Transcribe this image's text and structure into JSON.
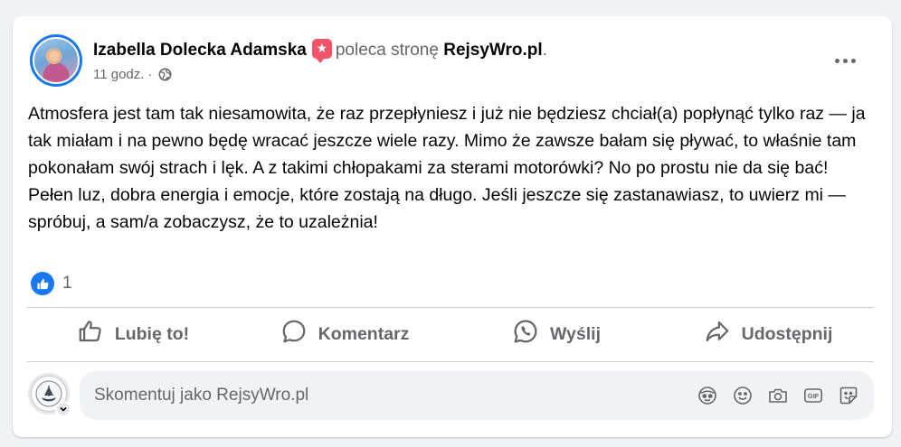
{
  "post": {
    "author": "Izabella Dolecka Adamska",
    "recommends_text": "poleca stronę",
    "page_name": "RejsyWro.pl",
    "page_suffix": ".",
    "time": "11 godz.",
    "separator": "·",
    "privacy_icon": "globe-icon",
    "text": "Atmosfera jest tam tak niesamowita, że raz przepłyniesz i już nie będziesz chciał(a) popłynąć tylko raz — ja tak miałam i na pewno będę wracać jeszcze wiele razy. Mimo że zawsze bałam się pływać, to właśnie tam pokonałam swój strach i lęk. A z takimi chłopakami za sterami motorówki? No po prostu nie da się bać! Pełen luz, dobra energia i emocje, które zostają na długo. Jeśli jeszcze się zastanawiasz, to uwierz mi — spróbuj, a sam/a zobaczysz, że to uzależnia!"
  },
  "reactions": {
    "icon": "like-icon",
    "count": "1"
  },
  "actions": {
    "like_label": "Lubię to!",
    "comment_label": "Komentarz",
    "send_label": "Wyślij",
    "share_label": "Udostępnij"
  },
  "comment": {
    "placeholder": "Skomentuj jako RejsyWro.pl",
    "tools": [
      "avatar-sticker-icon",
      "emoji-icon",
      "camera-icon",
      "gif-icon",
      "sticker-icon"
    ]
  },
  "colors": {
    "accent": "#1877f2",
    "recommend": "#f35369",
    "muted_text": "#65676b",
    "background": "#f0f2f5"
  }
}
